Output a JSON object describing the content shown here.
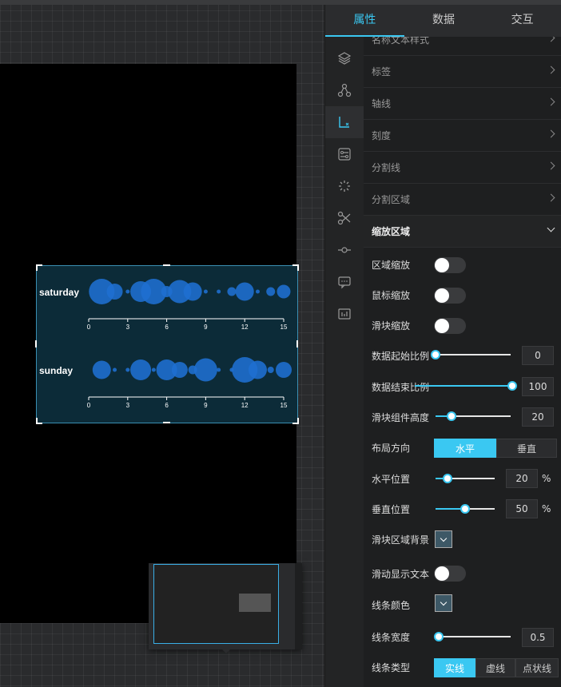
{
  "tabs": [
    {
      "label": "属性",
      "active": true
    },
    {
      "label": "数据",
      "active": false
    },
    {
      "label": "交互",
      "active": false
    }
  ],
  "rail_icons": [
    "layers-icon",
    "nodes-icon",
    "axis-icon",
    "settings-panel-icon",
    "loading-icon",
    "scissors-icon",
    "node-line-icon",
    "comment-icon",
    "data-table-icon"
  ],
  "sections": [
    {
      "label": "名称文本样式"
    },
    {
      "label": "标签"
    },
    {
      "label": "轴线"
    },
    {
      "label": "刻度"
    },
    {
      "label": "分割线"
    },
    {
      "label": "分割区域"
    },
    {
      "label": "缩放区域",
      "open": true
    }
  ],
  "zoom_settings": {
    "area_zoom": {
      "label": "区域缩放",
      "on": false
    },
    "mouse_zoom": {
      "label": "鼠标缩放",
      "on": false
    },
    "slider_zoom": {
      "label": "滑块缩放",
      "on": false
    },
    "data_start": {
      "label": "数据起始比例",
      "value": "0"
    },
    "data_end": {
      "label": "数据结束比例",
      "value": "100"
    },
    "slider_height": {
      "label": "滑块组件高度",
      "value": "20"
    },
    "layout": {
      "label": "布局方向",
      "options": [
        "水平",
        "垂直"
      ],
      "selected": "水平"
    },
    "h_pos": {
      "label": "水平位置",
      "value": "20",
      "unit": "%"
    },
    "v_pos": {
      "label": "垂直位置",
      "value": "50",
      "unit": "%"
    },
    "slider_bg": {
      "label": "滑块区域背景"
    },
    "drag_text": {
      "label": "滑动显示文本",
      "on": false
    },
    "line_color": {
      "label": "线条颜色"
    },
    "line_width": {
      "label": "线条宽度",
      "value": "0.5"
    },
    "line_type": {
      "label": "线条类型",
      "options": [
        "实线",
        "虚线",
        "点状线"
      ],
      "selected": "实线"
    }
  },
  "colors": {
    "accent": "#3ac8f2",
    "bubble": "#1f6fd1",
    "chart_bg": "#0c2b38"
  },
  "chart_data": {
    "type": "scatter",
    "title": "",
    "xlabel": "",
    "ylabel": "",
    "xlim": [
      0,
      15
    ],
    "x_ticks": [
      0,
      3,
      6,
      9,
      12,
      15
    ],
    "series": [
      {
        "name": "saturday",
        "points": [
          {
            "x": 1,
            "size": 10
          },
          {
            "x": 2,
            "size": 6
          },
          {
            "x": 3,
            "size": 1
          },
          {
            "x": 4,
            "size": 8
          },
          {
            "x": 5,
            "size": 10
          },
          {
            "x": 6,
            "size": 4
          },
          {
            "x": 7,
            "size": 9
          },
          {
            "x": 8,
            "size": 7
          },
          {
            "x": 9,
            "size": 1
          },
          {
            "x": 10,
            "size": 1
          },
          {
            "x": 11,
            "size": 3
          },
          {
            "x": 12,
            "size": 7
          },
          {
            "x": 13,
            "size": 1
          },
          {
            "x": 14,
            "size": 3
          },
          {
            "x": 15,
            "size": 5
          }
        ]
      },
      {
        "name": "sunday",
        "points": [
          {
            "x": 1,
            "size": 7
          },
          {
            "x": 2,
            "size": 1
          },
          {
            "x": 3,
            "size": 1
          },
          {
            "x": 4,
            "size": 8
          },
          {
            "x": 5,
            "size": 1
          },
          {
            "x": 6,
            "size": 8
          },
          {
            "x": 7,
            "size": 6
          },
          {
            "x": 8,
            "size": 3
          },
          {
            "x": 9,
            "size": 9
          },
          {
            "x": 10,
            "size": 1
          },
          {
            "x": 11,
            "size": 1
          },
          {
            "x": 12,
            "size": 10
          },
          {
            "x": 13,
            "size": 7
          },
          {
            "x": 14,
            "size": 2
          },
          {
            "x": 15,
            "size": 6
          }
        ]
      }
    ]
  }
}
